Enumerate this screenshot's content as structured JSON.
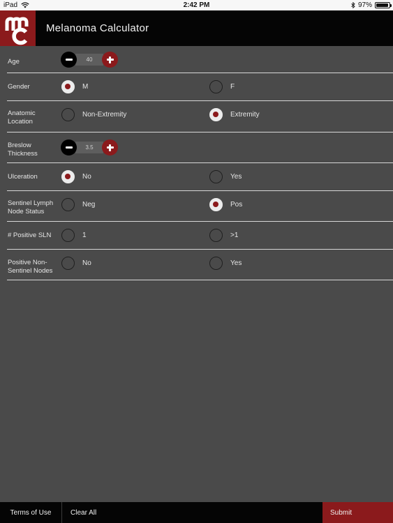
{
  "status_bar": {
    "device": "iPad",
    "time": "2:42 PM",
    "battery": "97%",
    "battery_level": 0.97
  },
  "header": {
    "title": "Melanoma Calculator",
    "logo_text": "mc"
  },
  "form": {
    "age": {
      "label": "Age",
      "value": "40"
    },
    "gender": {
      "label": "Gender",
      "options": [
        "M",
        "F"
      ],
      "selected": "M"
    },
    "anatomic_location": {
      "label": "Anatomic Location",
      "options": [
        "Non-Extremity",
        "Extremity"
      ],
      "selected": "Extremity"
    },
    "breslow_thickness": {
      "label": "Breslow Thickness",
      "value": "3.5"
    },
    "ulceration": {
      "label": "Ulceration",
      "options": [
        "No",
        "Yes"
      ],
      "selected": "No"
    },
    "sentinel_status": {
      "label": "Sentinel Lymph Node Status",
      "options": [
        "Neg",
        "Pos"
      ],
      "selected": "Pos"
    },
    "positive_sln": {
      "label": "# Positive SLN",
      "options": [
        "1",
        ">1"
      ],
      "selected": null
    },
    "positive_non_sentinel": {
      "label": "Positive Non-Sentinel Nodes",
      "options": [
        "No",
        "Yes"
      ],
      "selected": null
    }
  },
  "bottom_bar": {
    "terms": "Terms of Use",
    "clear": "Clear All",
    "submit": "Submit"
  },
  "colors": {
    "accent": "#8b1a1c",
    "background": "#4a4a4a",
    "bar": "#050505"
  }
}
